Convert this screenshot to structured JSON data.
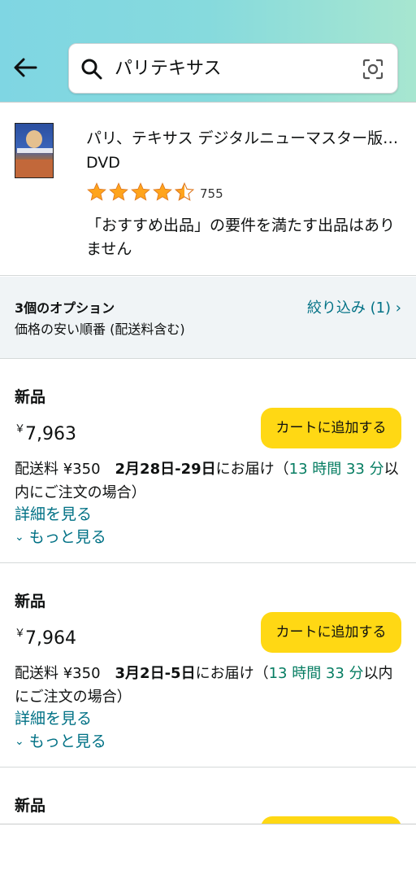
{
  "header": {
    "search_query": "パリテキサス"
  },
  "product": {
    "title": "パリ、テキサス デジタルニューマスター版 DVD",
    "format": "DVD",
    "rating_stars": 4.5,
    "rating_count": "755",
    "note": "「おすすめ出品」の要件を満たす出品はありません"
  },
  "options": {
    "count_label": "3個のオプション",
    "sort_label": "価格の安い順番 (配送料含む)",
    "filter_label": "絞り込み (1)"
  },
  "offers": [
    {
      "condition": "新品",
      "currency": "￥",
      "price": "7,963",
      "cart_label": "カートに追加する",
      "shipping": "配送料 ¥350",
      "delivery_date": "2月28日-29日",
      "delivery_suffix": "にお届け（",
      "countdown": "13 時間 33 分",
      "order_suffix": "以内にご注文の場合）",
      "details_label": "詳細を見る",
      "more_label": "もっと見る"
    },
    {
      "condition": "新品",
      "currency": "￥",
      "price": "7,964",
      "cart_label": "カートに追加する",
      "shipping": "配送料 ¥350",
      "delivery_date": "3月2日-5日",
      "delivery_suffix": "にお届け（",
      "countdown": "13 時間 33 分",
      "order_suffix": "以内にご注文の場合）",
      "details_label": "詳細を見る",
      "more_label": "もっと見る"
    },
    {
      "condition": "新品",
      "cart_label": ""
    }
  ],
  "colors": {
    "accent_link": "#007185",
    "cart_button": "#ffd814",
    "countdown_green": "#067d62",
    "star": "#ffa41c"
  },
  "icons": {
    "back": "arrow-left-icon",
    "search": "search-icon",
    "camera": "camera-scan-icon",
    "star": "star-icon",
    "chevron": "chevron-down-icon"
  }
}
